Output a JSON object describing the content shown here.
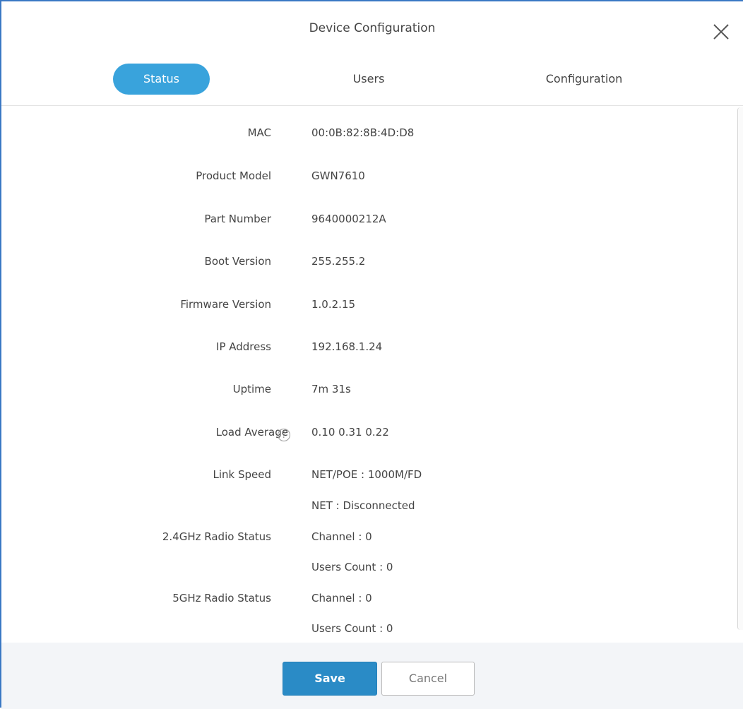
{
  "dialog": {
    "title": "Device Configuration"
  },
  "tabs": [
    {
      "label": "Status",
      "active": true
    },
    {
      "label": "Users",
      "active": false
    },
    {
      "label": "Configuration",
      "active": false
    }
  ],
  "status": {
    "mac": {
      "label": "MAC",
      "value": "00:0B:82:8B:4D:D8"
    },
    "product_model": {
      "label": "Product Model",
      "value": "GWN7610"
    },
    "part_number": {
      "label": "Part Number",
      "value": "9640000212A"
    },
    "boot_version": {
      "label": "Boot Version",
      "value": "255.255.2"
    },
    "firmware_version": {
      "label": "Firmware Version",
      "value": "1.0.2.15"
    },
    "ip_address": {
      "label": "IP Address",
      "value": "192.168.1.24"
    },
    "uptime": {
      "label": "Uptime",
      "value": "7m 31s"
    },
    "load_average": {
      "label": "Load Average",
      "help": "?",
      "value": "0.10 0.31 0.22"
    },
    "link_speed": {
      "label": "Link Speed",
      "values": [
        "NET/POE : 1000M/FD",
        "NET : Disconnected"
      ]
    },
    "radio_24": {
      "label": "2.4GHz Radio Status",
      "values": [
        "Channel : 0",
        "Users Count : 0"
      ]
    },
    "radio_5": {
      "label": "5GHz Radio Status",
      "values": [
        "Channel : 0",
        "Users Count : 0"
      ]
    }
  },
  "footer": {
    "save_label": "Save",
    "cancel_label": "Cancel"
  },
  "colors": {
    "accent": "#39a3dc",
    "save_button": "#2a8bc6"
  }
}
